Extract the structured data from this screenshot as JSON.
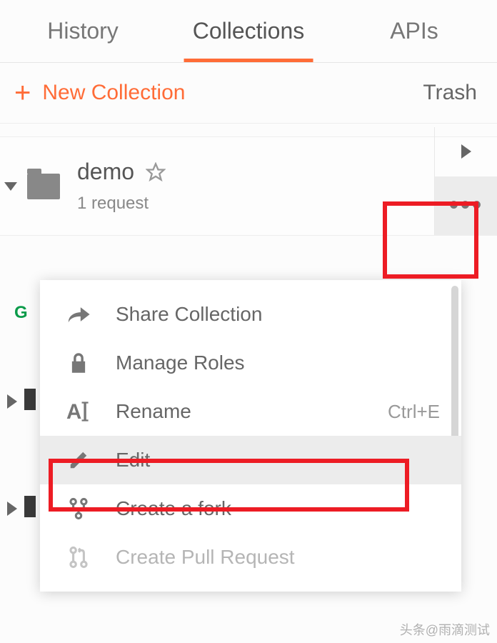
{
  "tabs": {
    "history": "History",
    "collections": "Collections",
    "apis": "APIs"
  },
  "toolbar": {
    "new_collection": "New Collection",
    "trash": "Trash"
  },
  "collection": {
    "name": "demo",
    "subtitle": "1 request"
  },
  "menu": {
    "share": "Share Collection",
    "manage_roles": "Manage Roles",
    "rename": "Rename",
    "rename_shortcut": "Ctrl+E",
    "edit": "Edit",
    "create_fork": "Create a fork",
    "create_pr": "Create Pull Request"
  },
  "watermark": "头条@雨滴测试"
}
